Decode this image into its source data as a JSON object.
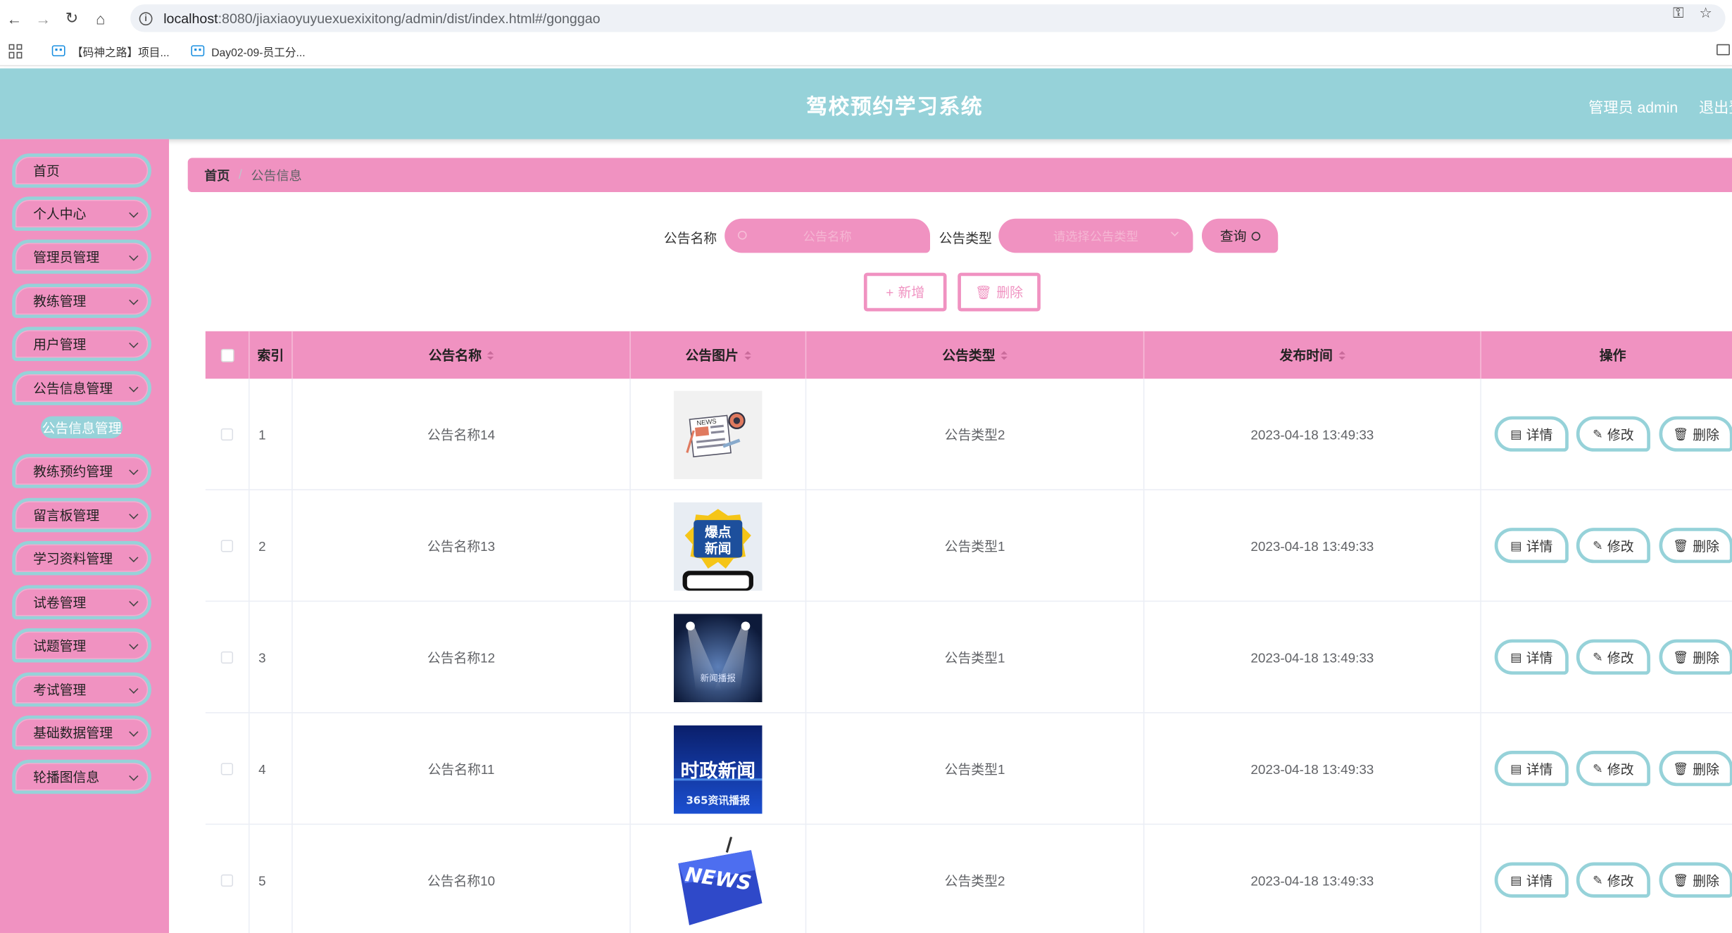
{
  "browser": {
    "url_host": "localhost",
    "url_path": ":8080/jiaxiaoyuyuexuexixitong/admin/dist/index.html#/gonggao",
    "bookmarks": [
      {
        "label": "【码神之路】项目..."
      },
      {
        "label": "Day02-09-员工分..."
      }
    ]
  },
  "header": {
    "title": "驾校预约学习系统",
    "user": "管理员 admin",
    "logout": "退出登"
  },
  "sidebar": {
    "items": [
      {
        "label": "首页",
        "has_chevron": false
      },
      {
        "label": "个人中心",
        "has_chevron": true
      },
      {
        "label": "管理员管理",
        "has_chevron": true
      },
      {
        "label": "教练管理",
        "has_chevron": true
      },
      {
        "label": "用户管理",
        "has_chevron": true
      },
      {
        "label": "公告信息管理",
        "has_chevron": true
      },
      {
        "label": "教练预约管理",
        "has_chevron": true
      },
      {
        "label": "留言板管理",
        "has_chevron": true
      },
      {
        "label": "学习资料管理",
        "has_chevron": true
      },
      {
        "label": "试卷管理",
        "has_chevron": true
      },
      {
        "label": "试题管理",
        "has_chevron": true
      },
      {
        "label": "考试管理",
        "has_chevron": true
      },
      {
        "label": "基础数据管理",
        "has_chevron": true
      },
      {
        "label": "轮播图信息",
        "has_chevron": true
      }
    ],
    "active_submenu": "公告信息管理"
  },
  "breadcrumb": {
    "home": "首页",
    "separator": "/",
    "current": "公告信息"
  },
  "search": {
    "name_label": "公告名称",
    "name_placeholder": "公告名称",
    "type_label": "公告类型",
    "type_placeholder": "请选择公告类型",
    "query_label": "查询"
  },
  "actions": {
    "add_label": "新增",
    "delete_label": "删除"
  },
  "table": {
    "columns": {
      "index": "索引",
      "name": "公告名称",
      "image": "公告图片",
      "type": "公告类型",
      "time": "发布时间",
      "ops": "操作"
    },
    "rows": [
      {
        "index": "1",
        "name": "公告名称14",
        "type": "公告类型2",
        "time": "2023-04-18 13:49:33",
        "image": "news-paper"
      },
      {
        "index": "2",
        "name": "公告名称13",
        "type": "公告类型1",
        "time": "2023-04-18 13:49:33",
        "image": "hot-news"
      },
      {
        "index": "3",
        "name": "公告名称12",
        "type": "公告类型1",
        "time": "2023-04-18 13:49:33",
        "image": "stage-news"
      },
      {
        "index": "4",
        "name": "公告名称11",
        "type": "公告类型1",
        "time": "2023-04-18 13:49:33",
        "image": "politics-news"
      },
      {
        "index": "5",
        "name": "公告名称10",
        "type": "公告类型2",
        "time": "2023-04-18 13:49:33",
        "image": "news-key"
      }
    ],
    "op_labels": {
      "detail": "详情",
      "edit": "修改",
      "delete": "删除"
    }
  },
  "thumbnail_text": {
    "news_paper": "NEWS",
    "hot_news_line1": "爆点",
    "hot_news_line2": "新闻",
    "stage_news": "新闻播报",
    "politics_line1": "时政新闻",
    "politics_line2": "365资讯播报",
    "news_key": "NEWS"
  },
  "colors": {
    "pink": "#f092c1",
    "teal": "#96d2d9"
  }
}
